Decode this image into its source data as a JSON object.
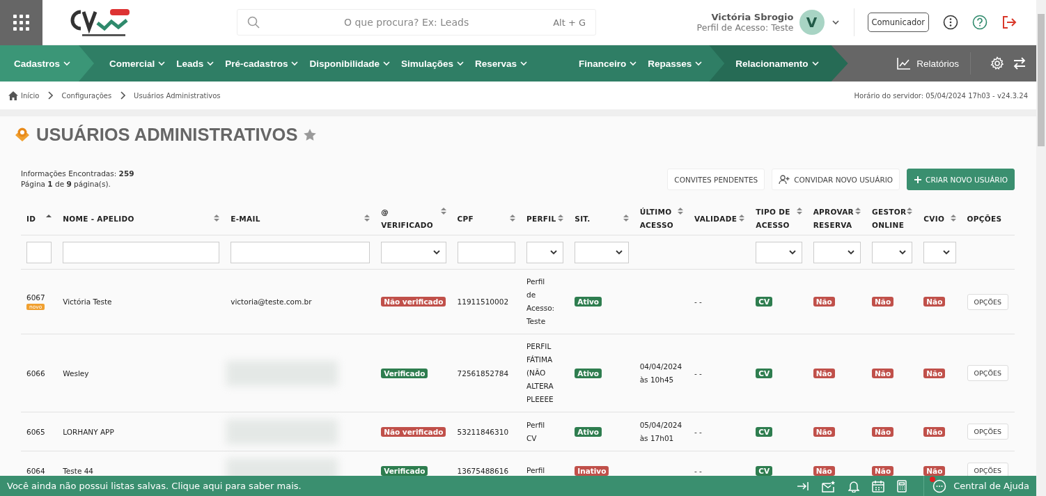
{
  "header": {
    "search": {
      "placeholder": "O que procura? Ex: Leads",
      "shortcut": "Alt + G"
    },
    "user": {
      "name": "Victória Sbrogio",
      "profile": "Perfil de Acesso: Teste",
      "initial": "V"
    },
    "communicator": "Comunicador"
  },
  "nav": {
    "groups": [
      {
        "color": "#3b9677",
        "items": [
          "Cadastros"
        ]
      },
      {
        "color": "#2f7e65",
        "items": [
          "Comercial",
          "Leads",
          "Pré-cadastros",
          "Disponibilidade",
          "Simulações",
          "Reservas"
        ]
      },
      {
        "color": "#2f7e65",
        "items": [
          "Financeiro",
          "Repasses"
        ]
      },
      {
        "color": "#266b55",
        "items": [
          "Relacionamento"
        ]
      }
    ],
    "reports": "Relatórios"
  },
  "breadcrumb": {
    "items": [
      "Início",
      "Configurações",
      "Usuários Administrativos"
    ],
    "server_time": "Horário do servidor: 05/04/2024 17h03 - v24.3.24"
  },
  "page": {
    "title": "USUÁRIOS ADMINISTRATIVOS",
    "favorite": false,
    "info": [
      "Informações Encontradas: **259**",
      "Página **1** de **9** página(s)."
    ],
    "buttons": [
      {
        "label": "CONVITES PENDENTES",
        "kind": "plain"
      },
      {
        "label": "CONVIDAR NOVO USUÁRIO",
        "kind": "invite"
      },
      {
        "label": "CRIAR NOVO USUÁRIO",
        "kind": "primary"
      }
    ]
  },
  "table": {
    "columns": [
      {
        "label": "ID",
        "sortable": true,
        "sorted_ascending": true,
        "kind": "text"
      },
      {
        "label": "NOME - APELIDO",
        "sortable": true,
        "sorted_ascending": false,
        "kind": "text"
      },
      {
        "label": "E-MAIL",
        "sortable": true,
        "sorted_ascending": false,
        "kind": "text"
      },
      {
        "label": "@\nVERIFICADO",
        "sortable": true,
        "sorted_ascending": false,
        "kind": "select"
      },
      {
        "label": "CPF",
        "sortable": true,
        "sorted_ascending": false,
        "kind": "text"
      },
      {
        "label": "PERFIL",
        "sortable": true,
        "sorted_ascending": false,
        "kind": "select"
      },
      {
        "label": "SIT.",
        "sortable": true,
        "sorted_ascending": false,
        "kind": "select"
      },
      {
        "label": "ÚLTIMO\nACESSO",
        "sortable": true,
        "sorted_ascending": false,
        "kind": "plain"
      },
      {
        "label": "VALIDADE",
        "sortable": true,
        "sorted_ascending": false,
        "kind": "plain"
      },
      {
        "label": "TIPO DE\nACESSO",
        "sortable": true,
        "sorted_ascending": false,
        "kind": "select"
      },
      {
        "label": "APROVAR\nRESERVA",
        "sortable": true,
        "sorted_ascending": false,
        "kind": "select"
      },
      {
        "label": "GESTOR\nONLINE",
        "sortable": true,
        "sorted_ascending": false,
        "kind": "select"
      },
      {
        "label": "CVIO",
        "sortable": true,
        "sorted_ascending": false,
        "kind": "select"
      },
      {
        "label": "OPÇÕES",
        "sortable": false,
        "kind": "plain"
      }
    ],
    "rows": [
      {
        "id": "6067",
        "tag": "novo",
        "name": "Victória Teste",
        "email": "victoria@teste.com.br",
        "verified": {
          "text": "Não verificado",
          "ok": false
        },
        "cpf": "11911510002",
        "profile": "Perfil\nde\nAcesso:\nTeste",
        "status": {
          "text": "Ativo",
          "ok": true
        },
        "last_access": "",
        "validity": "- -",
        "access_type": {
          "text": "CV",
          "ok": true
        },
        "approve": {
          "text": "Não",
          "ok": false
        },
        "manager": {
          "text": "Não",
          "ok": false
        },
        "cvio": {
          "text": "Não",
          "ok": false
        },
        "options": "OPÇÕES"
      },
      {
        "id": "6066",
        "name": "Wesley",
        "email_blurred": true,
        "verified": {
          "text": "Verificado",
          "ok": true
        },
        "cpf": "72561852784",
        "profile": "PERFIL\nFÁTIMA\n(NÃO\nALTERA\nPLEEEE",
        "status": {
          "text": "Ativo",
          "ok": true
        },
        "last_access": "04/04/2024\nàs 10h45",
        "validity": "- -",
        "access_type": {
          "text": "CV",
          "ok": true
        },
        "approve": {
          "text": "Não",
          "ok": false
        },
        "manager": {
          "text": "Não",
          "ok": false
        },
        "cvio": {
          "text": "Não",
          "ok": false
        },
        "options": "OPÇÕES"
      },
      {
        "id": "6065",
        "name": "LORHANY APP",
        "email_blurred": true,
        "verified": {
          "text": "Não verificado",
          "ok": false
        },
        "cpf": "53211846310",
        "profile": "Perfil\nCV",
        "status": {
          "text": "Ativo",
          "ok": true
        },
        "last_access": "05/04/2024\nàs 17h01",
        "validity": "- -",
        "access_type": {
          "text": "CV",
          "ok": true
        },
        "approve": {
          "text": "Não",
          "ok": false
        },
        "manager": {
          "text": "Não",
          "ok": false
        },
        "cvio": {
          "text": "Não",
          "ok": false
        },
        "options": "OPÇÕES"
      },
      {
        "id": "6064",
        "name": "Teste 44",
        "email_blurred": true,
        "verified": {
          "text": "Verificado",
          "ok": true
        },
        "cpf": "13675488616",
        "profile": "Perfil",
        "status": {
          "text": "Inativo",
          "ok": false
        },
        "last_access": "",
        "validity": "- -",
        "access_type": {
          "text": "CV",
          "ok": true
        },
        "approve": {
          "text": "Não",
          "ok": false
        },
        "manager": {
          "text": "Não",
          "ok": false
        },
        "cvio": {
          "text": "Não",
          "ok": false
        },
        "options": "OPÇÕES"
      }
    ]
  },
  "footer": {
    "message": "Você ainda não possui listas salvas. Clique aqui para saber mais.",
    "chat_unread": true,
    "help": "Central de Ajuda"
  }
}
